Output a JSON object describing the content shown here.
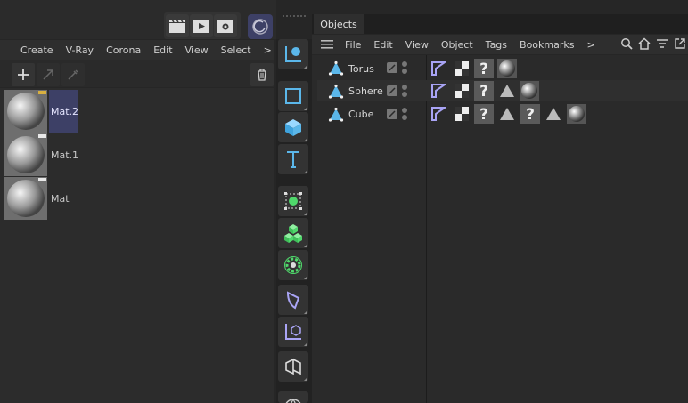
{
  "top_toolbar": {
    "icons": [
      "clapper-icon",
      "play-render-icon",
      "render-settings-icon",
      "cinema4d-logo-icon"
    ]
  },
  "material_manager": {
    "menu": [
      "Create",
      "V-Ray",
      "Corona",
      "Edit",
      "View",
      "Select",
      ">"
    ],
    "toolbar": [
      "add-icon",
      "arrow-icon",
      "eyedropper-icon",
      "trash-icon"
    ],
    "materials": [
      {
        "name": "Mat.2",
        "selected": true
      },
      {
        "name": "Mat.1",
        "selected": false
      },
      {
        "name": "Mat",
        "selected": false
      }
    ]
  },
  "palette": {
    "buttons": [
      "move-coords-icon",
      "rectangle-icon",
      "cube-icon",
      "text-tool-icon",
      "select-points-icon",
      "cloner-icon",
      "gear-gen-icon",
      "deformer-icon",
      "axis-icon",
      "bend-icon",
      "globe-icon"
    ]
  },
  "objects_panel": {
    "tab": "Objects",
    "menu": [
      "File",
      "Edit",
      "View",
      "Object",
      "Tags",
      "Bookmarks",
      ">"
    ],
    "accent": "#5bb7ea",
    "objects": [
      {
        "name": "Torus",
        "tags": [
          "phong",
          "checker",
          "question",
          "sphere-mat"
        ]
      },
      {
        "name": "Sphere",
        "tags": [
          "phong",
          "checker",
          "question",
          "triangle",
          "sphere-mat"
        ]
      },
      {
        "name": "Cube",
        "tags": [
          "phong",
          "checker",
          "question",
          "triangle",
          "question",
          "triangle",
          "sphere-mat"
        ]
      }
    ]
  }
}
